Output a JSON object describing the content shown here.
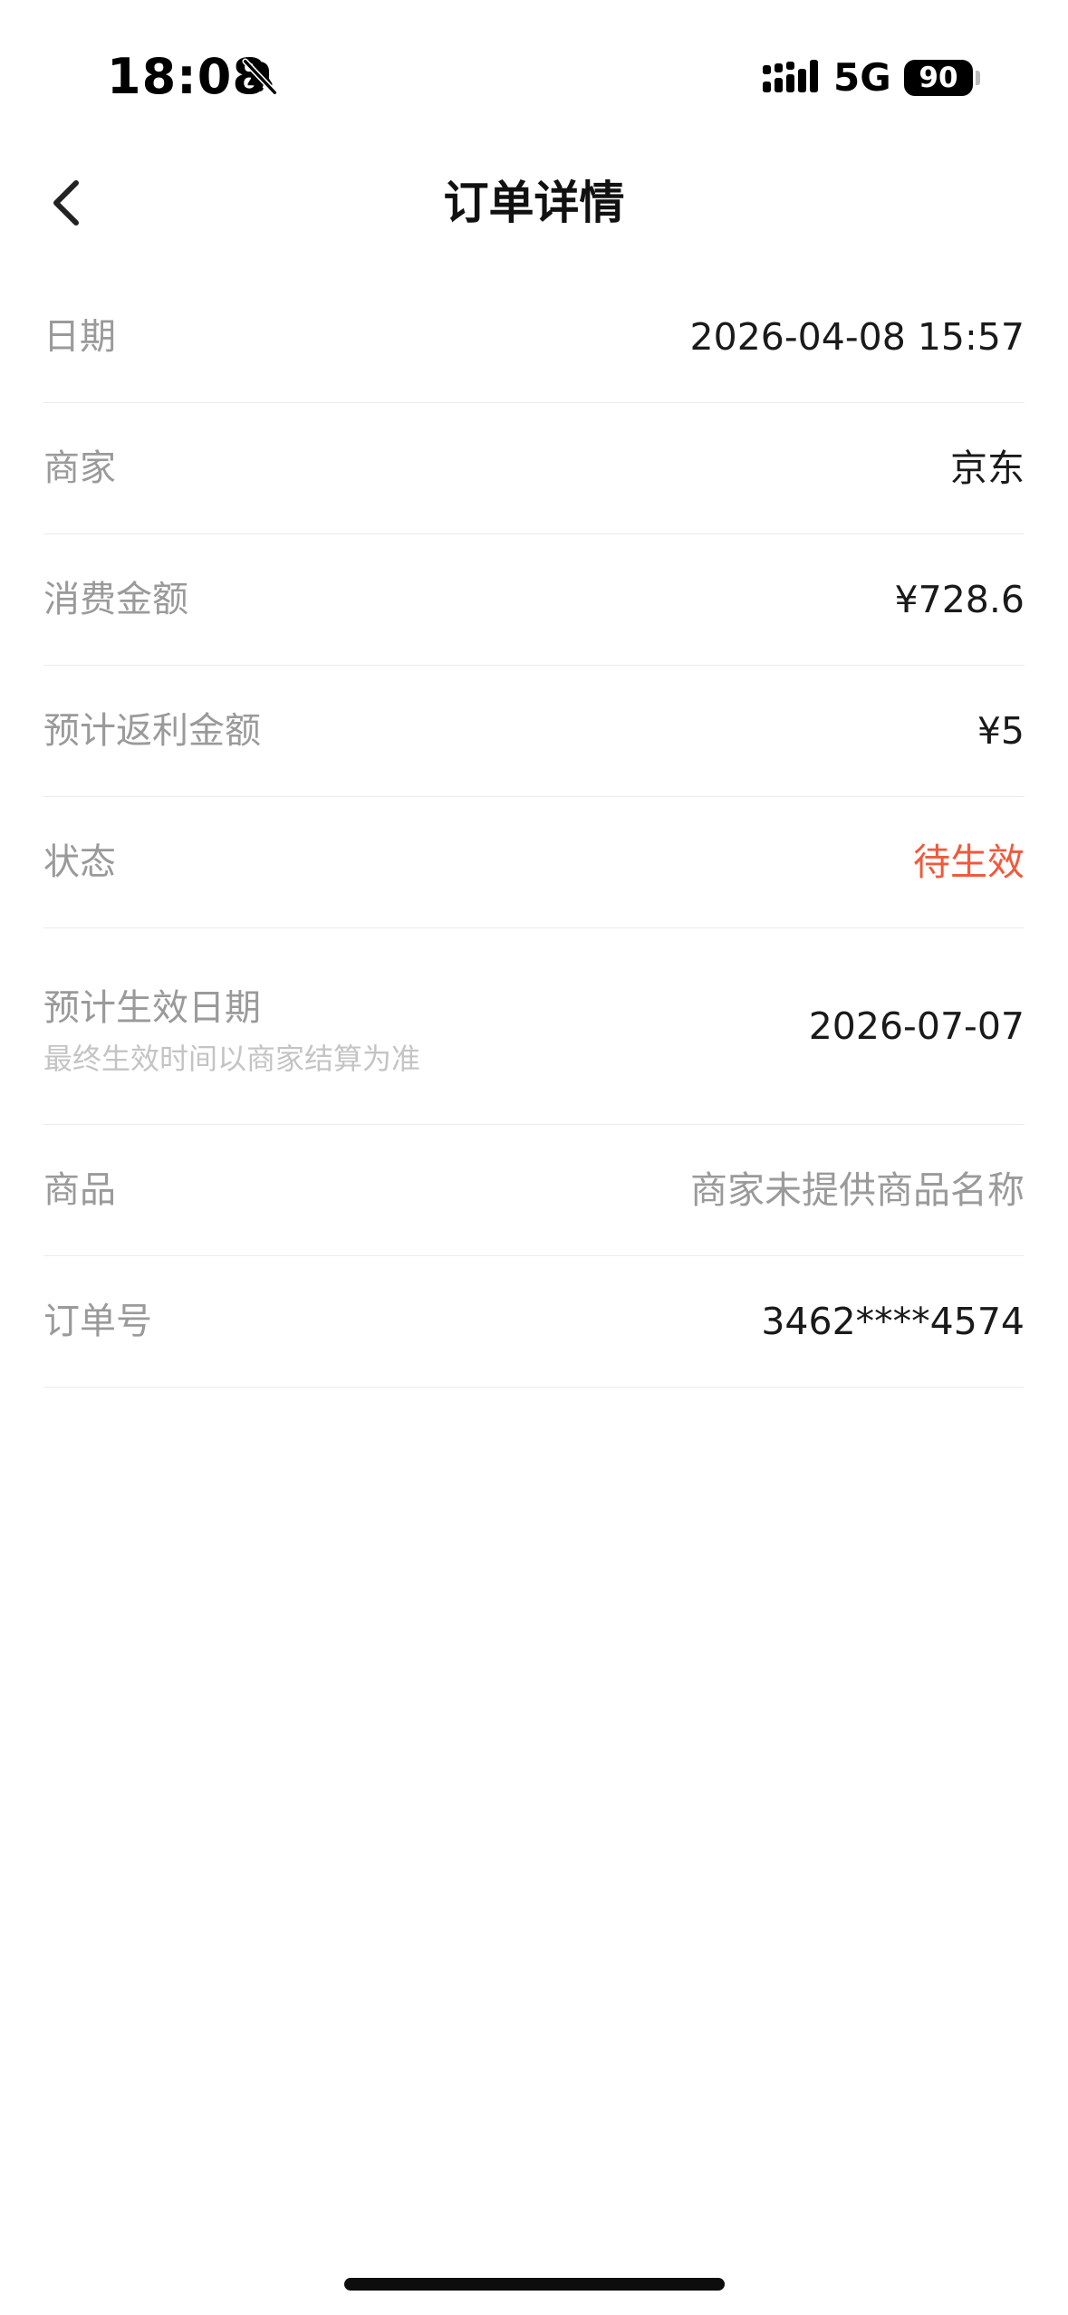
{
  "status_bar": {
    "time": "18:08",
    "network": "5G",
    "battery": "90",
    "icons": [
      "bell-slash-icon",
      "signal-icon",
      "battery-icon"
    ]
  },
  "nav": {
    "title": "订单详情",
    "back_icon": "chevron-left-icon"
  },
  "details": {
    "date": {
      "label": "日期",
      "value": "2026-04-08 15:57"
    },
    "merchant": {
      "label": "商家",
      "value": "京东"
    },
    "amount": {
      "label": "消费金额",
      "value": "¥728.6"
    },
    "rebate": {
      "label": "预计返利金额",
      "value": "¥5"
    },
    "status": {
      "label": "状态",
      "value": "待生效",
      "color": "#ef5a3c"
    },
    "effective_date": {
      "label": "预计生效日期",
      "sublabel": "最终生效时间以商家结算为准",
      "value": "2026-07-07"
    },
    "product": {
      "label": "商品",
      "value": "商家未提供商品名称"
    },
    "order_no": {
      "label": "订单号",
      "value": "3462****4574"
    }
  }
}
